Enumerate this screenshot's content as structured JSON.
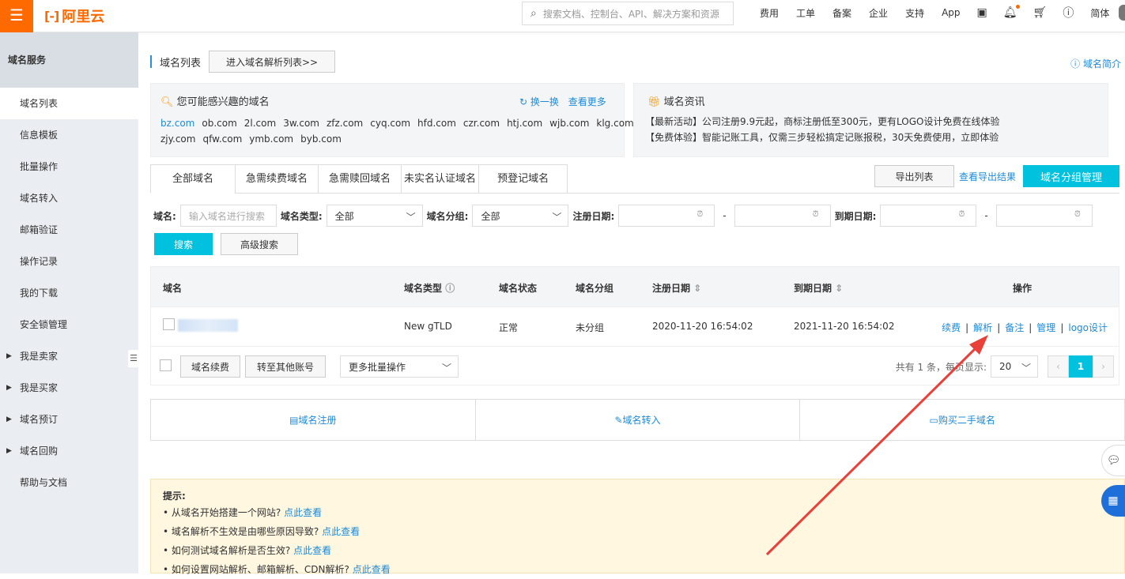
{
  "header": {
    "menu_icon": "☰",
    "brand_mark": "[-]",
    "brand_name": "阿里云",
    "search_placeholder": "搜索文档、控制台、API、解决方案和资源",
    "nav": [
      "费用",
      "工单",
      "备案",
      "企业",
      "支持",
      "App"
    ],
    "lang": "简体"
  },
  "sidebar": {
    "title": "域名服务",
    "items": [
      {
        "label": "域名列表",
        "active": true
      },
      {
        "label": "信息模板"
      },
      {
        "label": "批量操作"
      },
      {
        "label": "域名转入"
      },
      {
        "label": "邮箱验证"
      },
      {
        "label": "操作记录"
      },
      {
        "label": "我的下载"
      },
      {
        "label": "安全锁管理"
      },
      {
        "label": "我是卖家",
        "expandable": true
      },
      {
        "label": "我是买家",
        "expandable": true
      },
      {
        "label": "域名预订",
        "expandable": true
      },
      {
        "label": "域名回购",
        "expandable": true
      },
      {
        "label": "帮助与文档"
      }
    ]
  },
  "page": {
    "title": "域名列表",
    "enter_dns_btn": "进入域名解析列表>>",
    "help_link": "域名简介"
  },
  "recommend": {
    "title": "您可能感兴趣的域名",
    "refresh": "换一换",
    "more": "查看更多",
    "domains": [
      "bz.com",
      "ob.com",
      "2l.com",
      "3w.com",
      "zfz.com",
      "cyq.com",
      "hfd.com",
      "czr.com",
      "htj.com",
      "wjb.com",
      "klg.com",
      "zjy.com",
      "qfw.com",
      "ymb.com",
      "byb.com"
    ]
  },
  "news": {
    "title": "域名资讯",
    "lines": [
      "【最新活动】公司注册9.9元起，商标注册低至300元，更有LOGO设计免费在线体验",
      "【免费体验】智能记账工具，仅需三步轻松搞定记账报税，30天免费使用，立即体验"
    ]
  },
  "tabs": [
    "全部域名",
    "急需续费域名",
    "急需赎回域名",
    "未实名认证域名",
    "预登记域名"
  ],
  "actions": {
    "export": "导出列表",
    "export_results": "查看导出结果",
    "group_manage": "域名分组管理"
  },
  "filter": {
    "domain_label": "域名:",
    "domain_placeholder": "输入域名进行搜索",
    "type_label": "域名类型:",
    "type_value": "全部",
    "group_label": "域名分组:",
    "group_value": "全部",
    "reg_label": "注册日期:",
    "exp_label": "到期日期:",
    "dash": "-",
    "search_btn": "搜索",
    "advanced_btn": "高级搜索"
  },
  "table": {
    "headers": {
      "domain": "域名",
      "type": "域名类型",
      "status": "域名状态",
      "group": "域名分组",
      "reg": "注册日期",
      "exp": "到期日期",
      "ops": "操作"
    },
    "rows": [
      {
        "type": "New gTLD",
        "status": "正常",
        "group": "未分组",
        "reg": "2020-11-20 16:54:02",
        "exp": "2021-11-20 16:54:02"
      }
    ],
    "ops": [
      "续费",
      "解析",
      "备注",
      "管理",
      "logo设计"
    ],
    "footer": {
      "renew": "域名续费",
      "transfer": "转至其他账号",
      "more_batch": "更多批量操作",
      "total": "共有 1 条，每页显示:",
      "page_size": "20",
      "page": "1"
    }
  },
  "quick": [
    "域名注册",
    "域名转入",
    "购买二手域名"
  ],
  "tips": {
    "title": "提示:",
    "items": [
      {
        "text": "• 从域名开始搭建一个网站?",
        "link": "点此查看"
      },
      {
        "text": "• 域名解析不生效是由哪些原因导致?",
        "link": "点此查看"
      },
      {
        "text": "• 如何测试域名解析是否生效?",
        "link": "点此查看"
      },
      {
        "text": "• 如何设置网站解析、邮箱解析、CDN解析?",
        "link": "点此查看"
      }
    ]
  },
  "colors": {
    "accent": "#ff6a00",
    "primary": "#00c1de",
    "link": "#1e8bd6",
    "annotation": "#e8413a"
  }
}
